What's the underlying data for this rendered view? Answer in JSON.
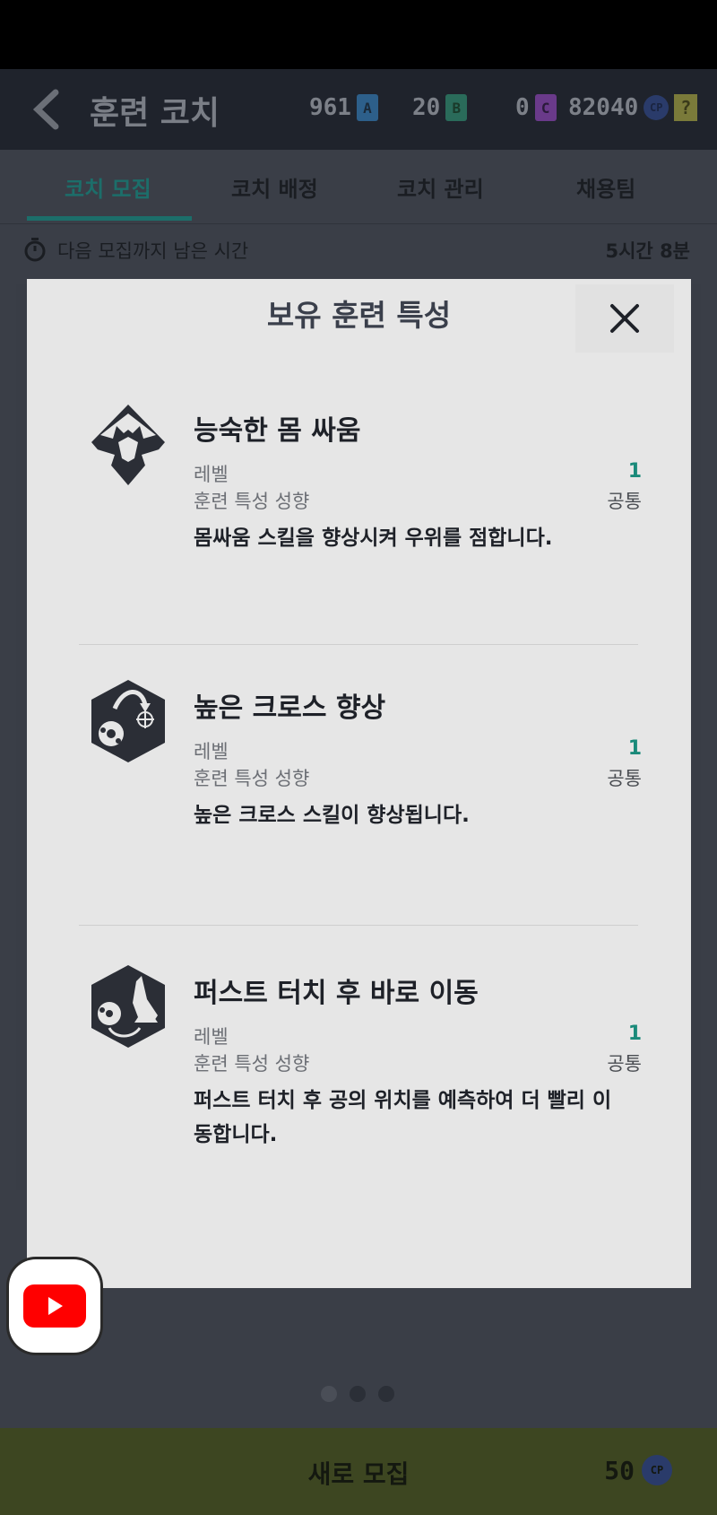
{
  "header": {
    "title": "훈련 코치",
    "currencies": [
      {
        "value": "961",
        "chip": "A",
        "color": "#2d5f8a"
      },
      {
        "value": "20",
        "chip": "B",
        "color": "#2a6b5a"
      },
      {
        "value": "0",
        "chip": "C",
        "color": "#6a3a8a"
      },
      {
        "value": "82040",
        "chip": "CP",
        "color": "#2a3b6a"
      }
    ],
    "help_label": "?"
  },
  "tabs": [
    {
      "label": "코치 모집",
      "active": true
    },
    {
      "label": "코치 배정",
      "active": false
    },
    {
      "label": "코치 관리",
      "active": false
    },
    {
      "label": "채용팀",
      "active": false
    }
  ],
  "timer": {
    "label": "다음 모집까지 남은 시간",
    "value": "5시간 8분"
  },
  "modal": {
    "title": "보유 훈련 특성",
    "traits": [
      {
        "name": "능숙한 몸 싸움",
        "level_label": "레벨",
        "level_value": "1",
        "type_label": "훈련 특성 성향",
        "type_value": "공통",
        "description": "몸싸움 스킬을 향상시켜 우위를 점합니다.",
        "icon": "wrestle-icon"
      },
      {
        "name": "높은 크로스 향상",
        "level_label": "레벨",
        "level_value": "1",
        "type_label": "훈련 특성 성향",
        "type_value": "공통",
        "description": "높은 크로스 스킬이 향상됩니다.",
        "icon": "high-cross-icon"
      },
      {
        "name": "퍼스트 터치 후 바로 이동",
        "level_label": "레벨",
        "level_value": "1",
        "type_label": "훈련 특성 성향",
        "type_value": "공통",
        "description": "퍼스트 터치 후 공의 위치를 예측하여 더 빨리 이동합니다.",
        "icon": "first-touch-icon"
      }
    ]
  },
  "pager": {
    "count": 3,
    "active": 0
  },
  "recruit": {
    "label": "새로 모집",
    "cost": "50",
    "currency": "CP"
  }
}
